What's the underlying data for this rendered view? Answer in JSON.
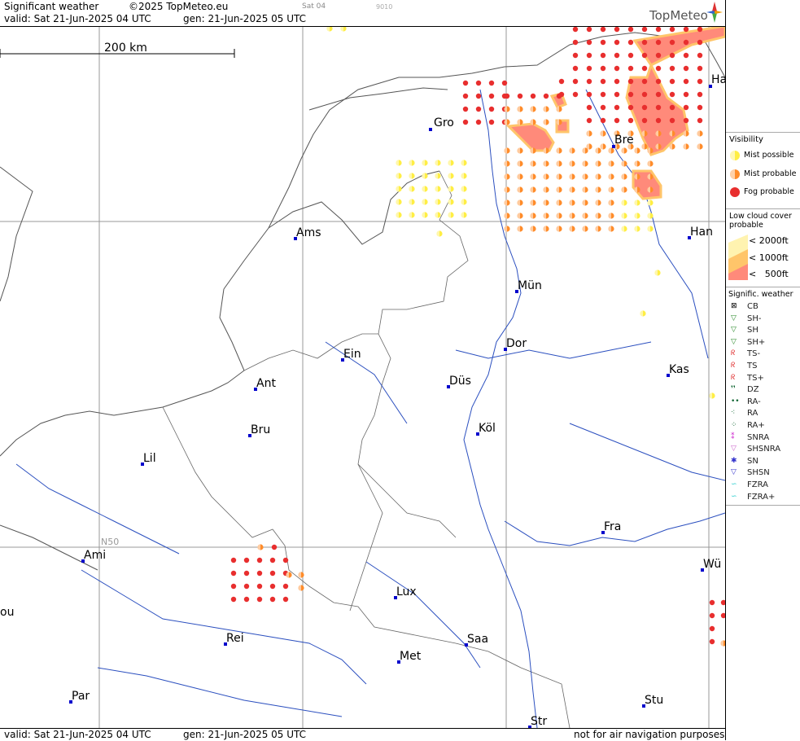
{
  "header": {
    "title": "Significant weather",
    "copyright": "©2025 TopMeteo.eu",
    "day_tab": "Sat 04",
    "code": "9010",
    "valid": "valid:  Sat  21-Jun-2025  04 UTC",
    "gen": "gen: 21-Jun-2025 05 UTC",
    "logo": "TopMeteo"
  },
  "footer": {
    "valid": "valid:  Sat  21-Jun-2025  04 UTC",
    "gen": "gen: 21-Jun-2025 05 UTC",
    "disclaimer": "not for air navigation purposes"
  },
  "map": {
    "scale_label": "200 km",
    "lat_label": "N50",
    "cities": [
      {
        "name": "Gro"
      },
      {
        "name": "Bre"
      },
      {
        "name": "Ha"
      },
      {
        "name": "Ams"
      },
      {
        "name": "Han"
      },
      {
        "name": "Mün"
      },
      {
        "name": "Ein"
      },
      {
        "name": "Dor"
      },
      {
        "name": "Kas"
      },
      {
        "name": "Ant"
      },
      {
        "name": "Düs"
      },
      {
        "name": "Bru"
      },
      {
        "name": "Köl"
      },
      {
        "name": "Lil"
      },
      {
        "name": "Fra"
      },
      {
        "name": "Ami"
      },
      {
        "name": "Wü"
      },
      {
        "name": "Lux"
      },
      {
        "name": "ou"
      },
      {
        "name": "Rei"
      },
      {
        "name": "Saa"
      },
      {
        "name": "Met"
      },
      {
        "name": "Par"
      },
      {
        "name": "Stu"
      },
      {
        "name": "Str"
      }
    ]
  },
  "legend": {
    "visibility_title": "Visibility",
    "visibility": [
      {
        "label": "Mist possible",
        "color": "#ffee44"
      },
      {
        "label": "Mist probable",
        "color": "#ff8c2a"
      },
      {
        "label": "Fog probable",
        "color": "#e82e2e"
      }
    ],
    "low_cloud_title_1": "Low cloud cover",
    "low_cloud_title_2": "probable",
    "low_cloud": [
      {
        "label": "< 2000ft",
        "color": "#fff3b0"
      },
      {
        "label": "< 1000ft",
        "color": "#ffc56a"
      },
      {
        "label": "<   500ft",
        "color": "#ff8a7a"
      }
    ],
    "sigwx_title": "Signific. weather",
    "sigwx": [
      {
        "label": "CB",
        "icon": "cb-icon"
      },
      {
        "label": "SH-",
        "icon": "shower-light-icon"
      },
      {
        "label": "SH",
        "icon": "shower-icon"
      },
      {
        "label": "SH+",
        "icon": "shower-heavy-icon"
      },
      {
        "label": "TS-",
        "icon": "thunderstorm-light-icon"
      },
      {
        "label": "TS",
        "icon": "thunderstorm-icon"
      },
      {
        "label": "TS+",
        "icon": "thunderstorm-heavy-icon"
      },
      {
        "label": "DZ",
        "icon": "drizzle-icon"
      },
      {
        "label": "RA-",
        "icon": "rain-light-icon"
      },
      {
        "label": "RA",
        "icon": "rain-icon"
      },
      {
        "label": "RA+",
        "icon": "rain-heavy-icon"
      },
      {
        "label": "SNRA",
        "icon": "snow-rain-icon"
      },
      {
        "label": "SHSNRA",
        "icon": "snow-rain-shower-icon"
      },
      {
        "label": "SN",
        "icon": "snow-icon"
      },
      {
        "label": "SHSN",
        "icon": "snow-shower-icon"
      },
      {
        "label": "FZRA",
        "icon": "freezing-rain-icon"
      },
      {
        "label": "FZRA+",
        "icon": "freezing-rain-heavy-icon"
      }
    ]
  }
}
